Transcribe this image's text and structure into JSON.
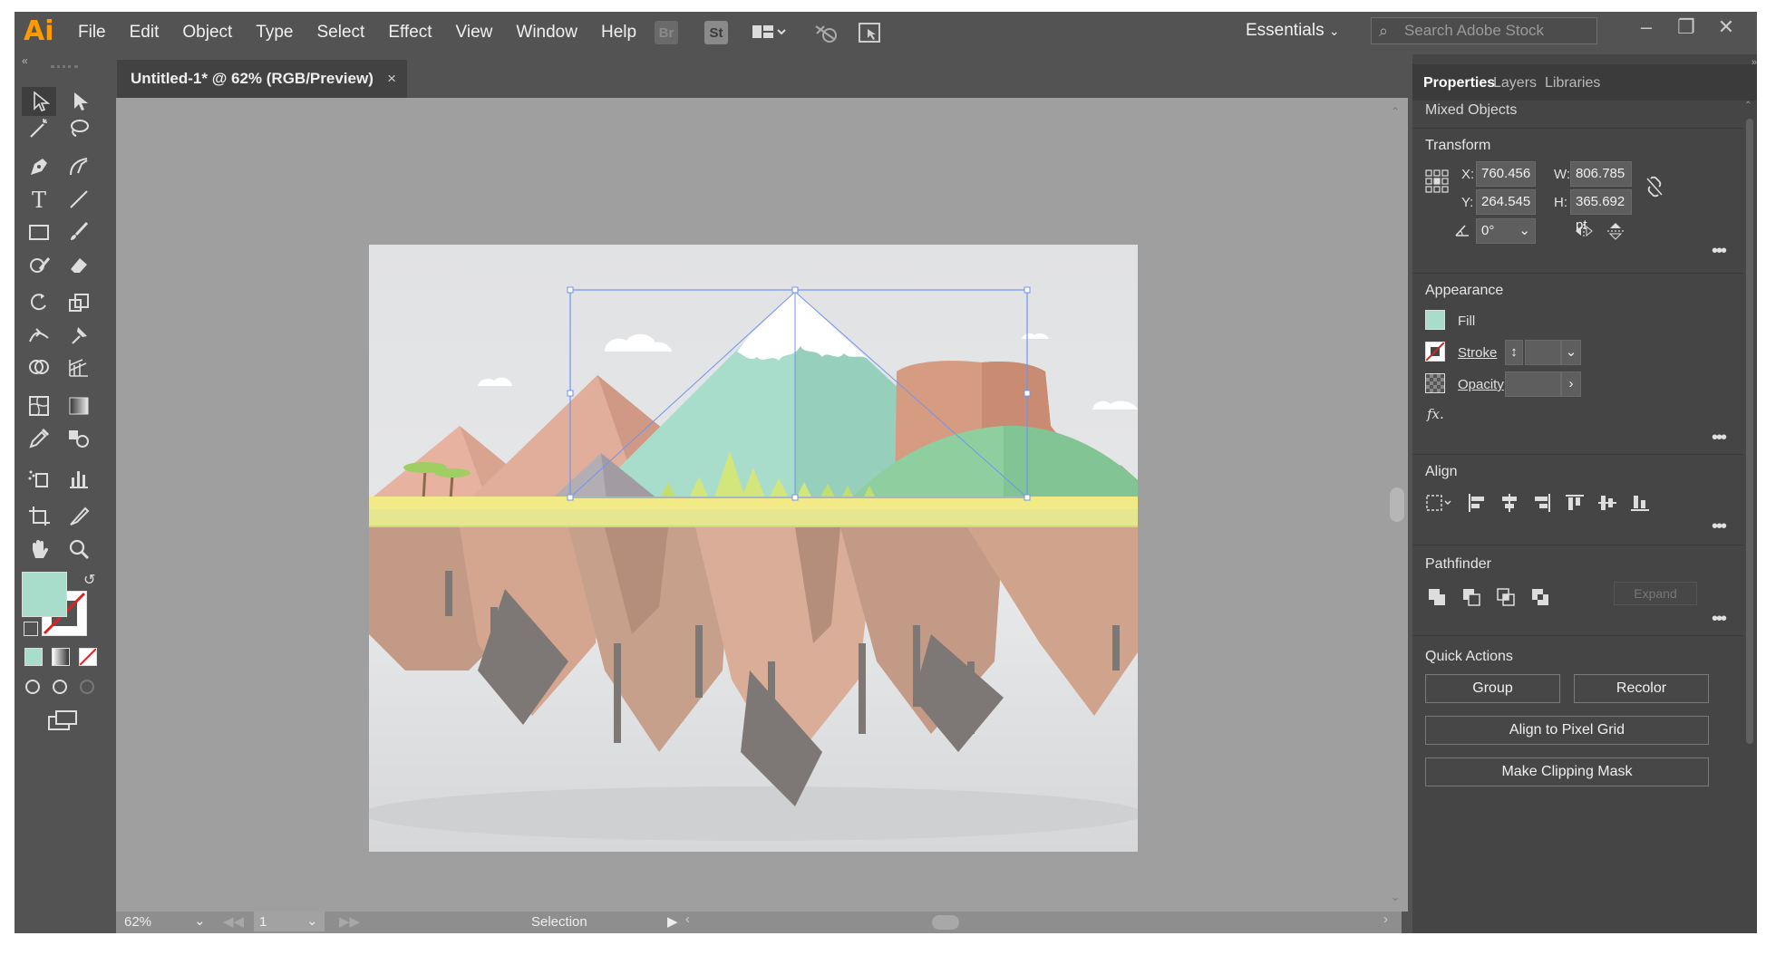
{
  "app": {
    "logo": "Ai"
  },
  "menu": [
    "File",
    "Edit",
    "Object",
    "Type",
    "Select",
    "Effect",
    "View",
    "Window",
    "Help"
  ],
  "toolbar_icons": {
    "bridge": "Br",
    "stock": "St"
  },
  "workspace": "Essentials",
  "search": {
    "placeholder": "Search Adobe Stock"
  },
  "document_tab": {
    "title": "Untitled-1* @ 62% (RGB/Preview)",
    "close": "×"
  },
  "panel": {
    "tabs": [
      "Properties",
      "Layers",
      "Libraries"
    ],
    "selection_type": "Mixed Objects",
    "transform": {
      "title": "Transform",
      "x_label": "X:",
      "x": "760.456 pt",
      "y_label": "Y:",
      "y": "264.545 pt",
      "w_label": "W:",
      "w": "806.785 pt",
      "h_label": "H:",
      "h": "365.692 pt",
      "angle": "0°"
    },
    "appearance": {
      "title": "Appearance",
      "fill": "Fill",
      "stroke": "Stroke",
      "opacity": "Opacity",
      "fx": "fx.",
      "fill_color": "#a8dccb"
    },
    "align": {
      "title": "Align"
    },
    "pathfinder": {
      "title": "Pathfinder",
      "expand": "Expand"
    },
    "quick_actions": {
      "title": "Quick Actions",
      "group": "Group",
      "recolor": "Recolor",
      "align_pixel": "Align to Pixel Grid",
      "clipping_mask": "Make Clipping Mask"
    }
  },
  "status": {
    "zoom": "62%",
    "artboard": "1",
    "tool": "Selection"
  },
  "colors": {
    "accent_logo": "#ff9a00",
    "selection": "#5b8cff"
  }
}
